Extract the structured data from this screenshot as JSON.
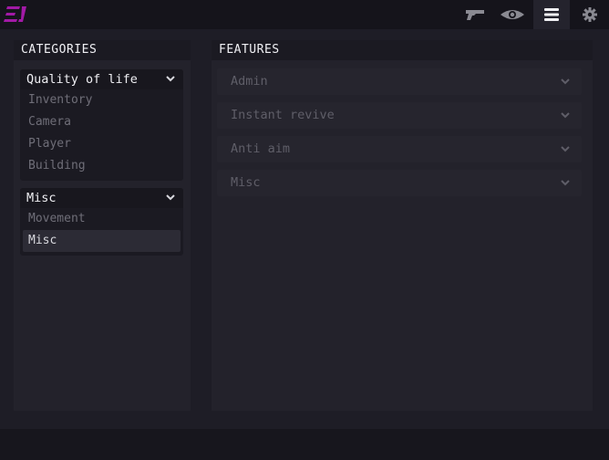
{
  "app": {
    "logo_name": "brand-logo",
    "accent_color": "#a21aa6"
  },
  "toolbar": {
    "icons": [
      "pistol-icon",
      "eye-icon",
      "menu-icon",
      "gear-icon"
    ],
    "active_icon": "menu-icon"
  },
  "categories": {
    "header": "CATEGORIES",
    "groups": [
      {
        "title": "Quality of life",
        "items": [
          "Inventory",
          "Camera",
          "Player",
          "Building"
        ]
      },
      {
        "title": "Misc",
        "items": [
          "Movement",
          "Misc"
        ],
        "selected": "Misc"
      }
    ]
  },
  "features": {
    "header": "FEATURES",
    "items": [
      "Admin",
      "Instant revive",
      "Anti aim",
      "Misc"
    ]
  }
}
